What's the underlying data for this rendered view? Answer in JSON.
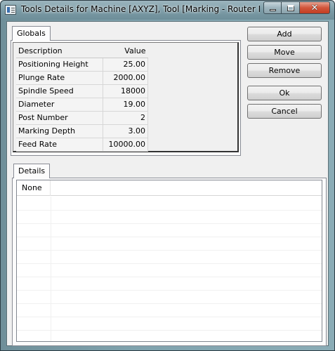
{
  "window": {
    "title": "Tools Details for Machine [AXYZ], Tool [Marking - Router Mark]"
  },
  "globals": {
    "tab_label": "Globals",
    "headers": {
      "description": "Description",
      "value": "Value"
    },
    "rows": [
      {
        "description": "Positioning Height",
        "value": "25.00"
      },
      {
        "description": "Plunge Rate",
        "value": "2000.00"
      },
      {
        "description": "Spindle Speed",
        "value": "18000"
      },
      {
        "description": "Diameter",
        "value": "19.00"
      },
      {
        "description": "Post Number",
        "value": "2"
      },
      {
        "description": "Marking Depth",
        "value": "3.00"
      },
      {
        "description": "Feed Rate",
        "value": "10000.00"
      }
    ]
  },
  "buttons": {
    "add": "Add",
    "move": "Move",
    "remove": "Remove",
    "ok": "Ok",
    "cancel": "Cancel"
  },
  "details": {
    "tab_label": "Details",
    "column_header": "None"
  },
  "icons": {
    "app": "window-app-icon",
    "minimize": "minimize-icon",
    "maximize": "maximize-icon",
    "close": "close-icon"
  }
}
